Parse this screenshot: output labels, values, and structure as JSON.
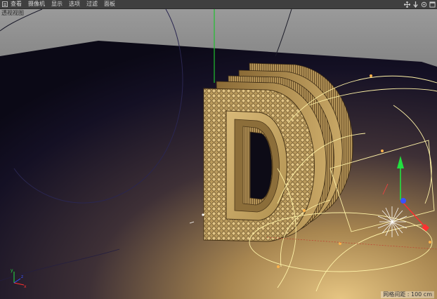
{
  "menubar": {
    "items": [
      "查看",
      "摄像机",
      "显示",
      "选项",
      "过滤",
      "面板"
    ]
  },
  "viewport": {
    "label": "透视视图",
    "scale_readout": "网格间距 : 100 cm"
  },
  "icons": {
    "menu": "menu-toggle-icon",
    "nav": [
      "move-view-icon",
      "dolly-view-icon",
      "rotate-view-icon",
      "maximize-view-icon"
    ]
  },
  "colors": {
    "menubar_bg": "#3f3f3f",
    "sky": "#8a8a8a",
    "floor_dark": "#0d0b1a",
    "floor_light": "#d8b878",
    "object_gold": "#c9a866",
    "axis_x": "#ff3030",
    "axis_y": "#22e040",
    "axis_z": "#3a50ff",
    "light_curve": "#fff5b0"
  },
  "gizmo": {
    "axes": [
      "y",
      "x",
      "z"
    ]
  }
}
